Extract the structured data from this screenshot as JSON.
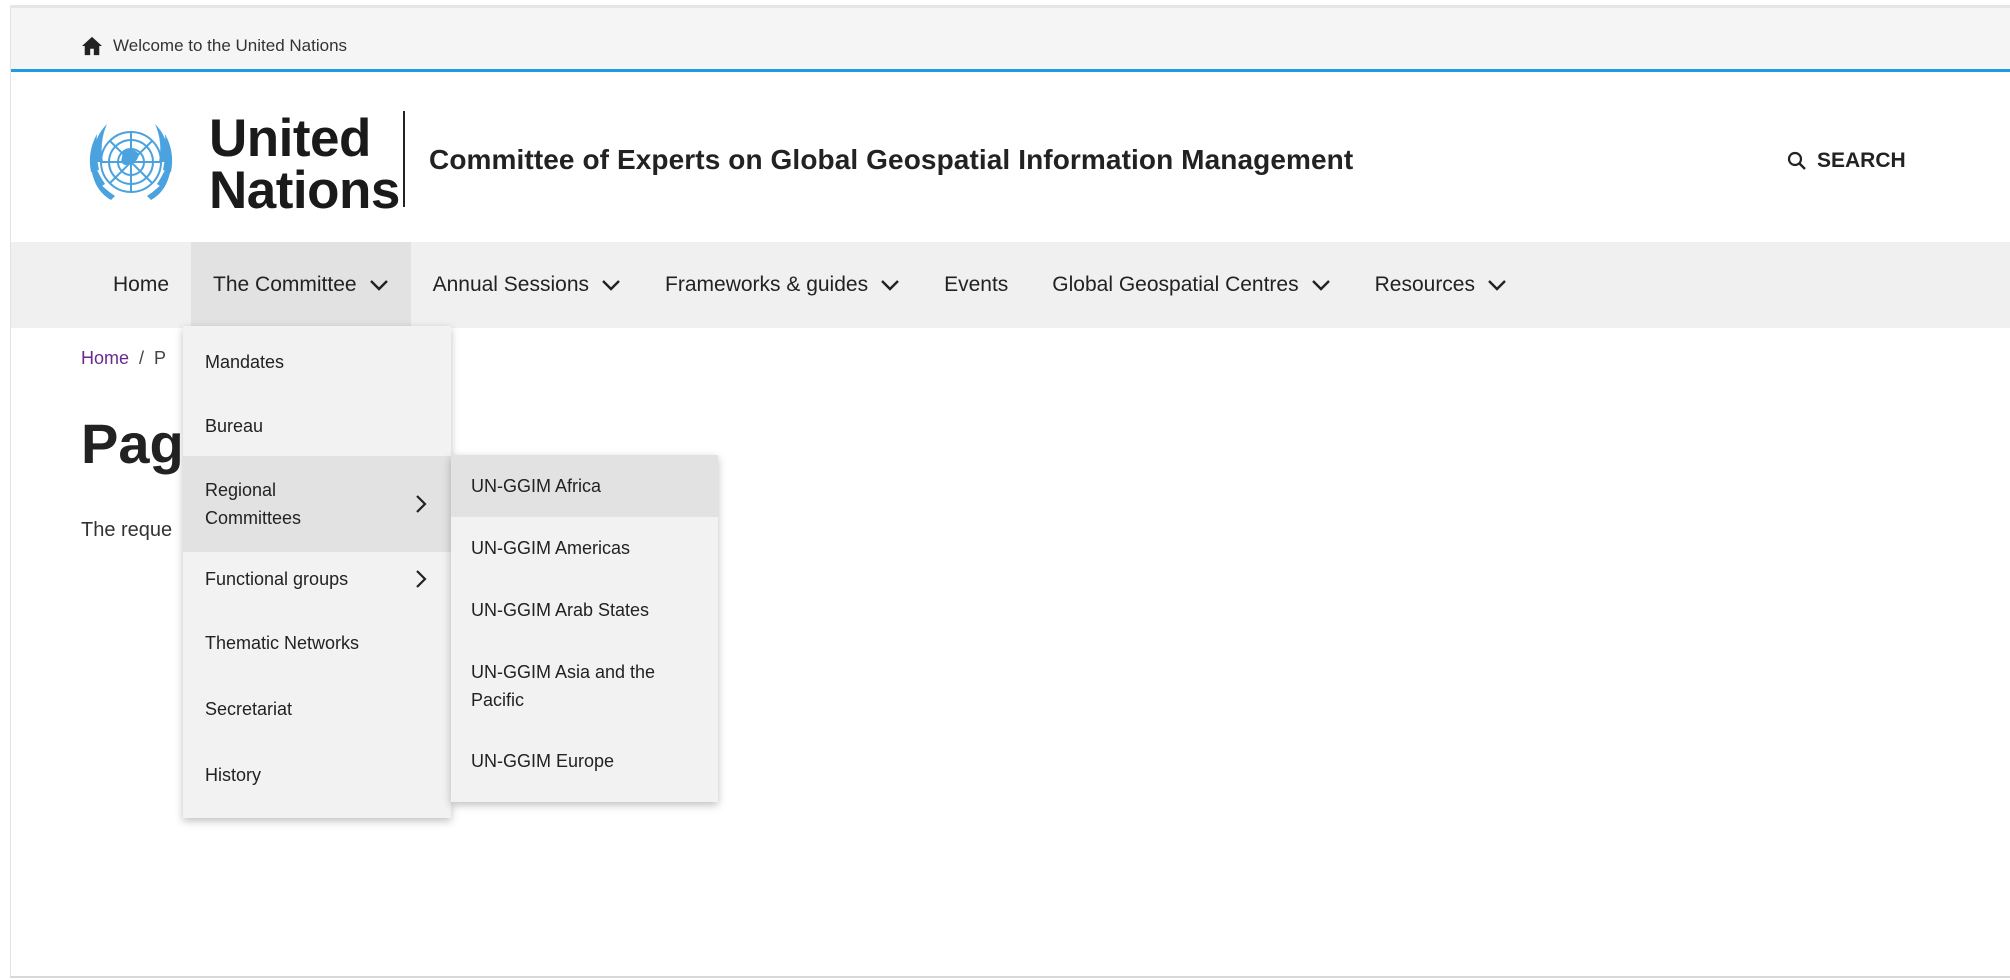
{
  "topbar": {
    "welcome_text": "Welcome to the United Nations",
    "home_icon": "home-icon"
  },
  "header": {
    "logo_line1": "United",
    "logo_line2": "Nations",
    "site_title": "Committee of Experts on Global Geospatial Information Management",
    "search_label": "SEARCH",
    "accent_color": "#1f9bde"
  },
  "nav": {
    "items": [
      {
        "label": "Home",
        "dropdown": false
      },
      {
        "label": "The Committee",
        "dropdown": true,
        "active": true
      },
      {
        "label": "Annual Sessions",
        "dropdown": true
      },
      {
        "label": "Frameworks & guides",
        "dropdown": true
      },
      {
        "label": "Events",
        "dropdown": false
      },
      {
        "label": "Global Geospatial Centres",
        "dropdown": true
      },
      {
        "label": "Resources",
        "dropdown": true
      }
    ]
  },
  "breadcrumb": {
    "home": "Home",
    "separator": "/",
    "current": "P"
  },
  "page": {
    "title": "Page",
    "text": "The reque"
  },
  "committee_menu": {
    "items": [
      {
        "label": "Mandates"
      },
      {
        "label": "Bureau"
      },
      {
        "label": "Regional Committees",
        "submenu": true,
        "hover": true
      },
      {
        "label": "Functional groups",
        "submenu": true
      },
      {
        "label": "Thematic Networks"
      },
      {
        "label": "Secretariat"
      },
      {
        "label": "History"
      }
    ]
  },
  "regional_menu": {
    "items": [
      {
        "label": "UN-GGIM Africa",
        "hover": true
      },
      {
        "label": "UN-GGIM Americas"
      },
      {
        "label": "UN-GGIM Arab States"
      },
      {
        "label": "UN-GGIM Asia and the Pacific"
      },
      {
        "label": "UN-GGIM Europe"
      }
    ]
  }
}
